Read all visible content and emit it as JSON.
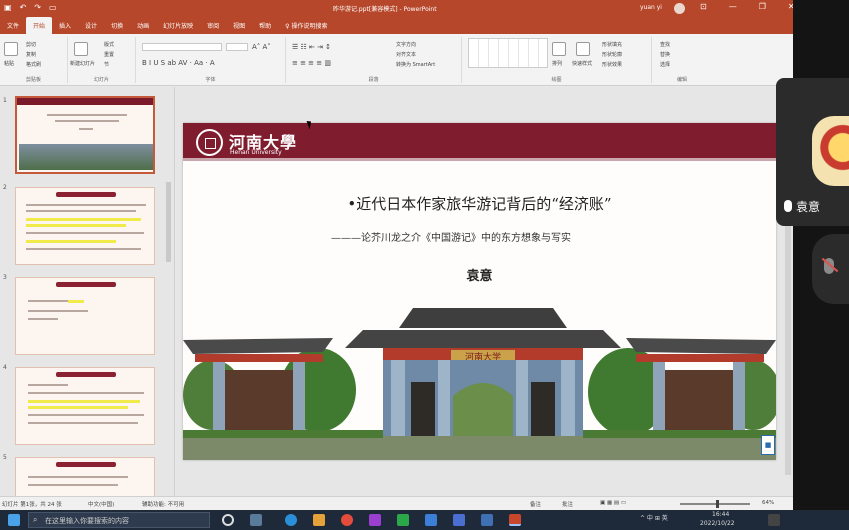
{
  "titlebar": {
    "doc_title": "昨华游记.ppt[兼容模式] - PowerPoint",
    "user": "yuan yi",
    "min": "—",
    "restore": "❐",
    "close": "✕"
  },
  "ribbon_tabs": [
    "文件",
    "开始",
    "插入",
    "设计",
    "切换",
    "动画",
    "幻灯片放映",
    "审阅",
    "视图",
    "帮助",
    "♀ 操作说明搜索"
  ],
  "ribbon": {
    "paste": "粘贴",
    "cut": "剪切",
    "copy": "复制",
    "format_painter": "格式刷",
    "new_slide": "新建幻灯片",
    "layout": "版式",
    "reset": "重置",
    "section": "节",
    "text_direction": "文字方向",
    "align_text": "对齐文本",
    "smartart": "转换为 SmartArt",
    "arrange": "排列",
    "quick_styles": "快速样式",
    "shape_fill": "形状填充",
    "shape_outline": "形状轮廓",
    "shape_effects": "形状效果",
    "find": "查找",
    "replace": "替换",
    "select": "选择",
    "group_clipboard": "剪贴板",
    "group_slides": "幻灯片",
    "group_font": "字体",
    "group_paragraph": "段落",
    "group_drawing": "绘图",
    "group_editing": "编辑"
  },
  "thumbnails": [
    {
      "num": "1",
      "selected": true
    },
    {
      "num": "2",
      "selected": false
    },
    {
      "num": "3",
      "selected": false
    },
    {
      "num": "4",
      "selected": false
    },
    {
      "num": "5",
      "selected": false
    }
  ],
  "slide": {
    "logo_cn": "河南大學",
    "logo_en": "Henan University",
    "title": "•近代日本作家旅华游记背后的“经济账”",
    "subtitle": "———论芥川龙之介《中国游记》中的东方想象与写实",
    "author": "袁意",
    "gate_sign": "河南大学",
    "badge": "■"
  },
  "statusbar": {
    "slide_count": "幻灯片 第1张，共 24 张",
    "language": "中文(中国)",
    "accessibility": "辅助功能: 不可用",
    "notes": "备注",
    "comments": "批注",
    "zoom": "64%"
  },
  "taskbar": {
    "search_placeholder": "在这里输入你要搜索的内容",
    "tray_text": "^ 中 ⊞ 英",
    "time": "16:44",
    "date": "2022/10/22"
  },
  "meeting": {
    "speaker_name": "袁意"
  },
  "colors": {
    "ppt_accent": "#b7472a",
    "slide_header": "#7f1d2e",
    "taskbar": "#1e2a3a"
  }
}
